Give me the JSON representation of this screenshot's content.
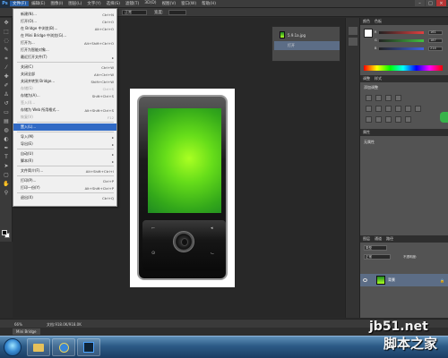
{
  "menubar": {
    "logo": "Ps",
    "items": [
      "文件(F)",
      "编辑(E)",
      "图像(I)",
      "图层(L)",
      "文字(Y)",
      "选择(S)",
      "滤镜(T)",
      "3D(D)",
      "视图(V)",
      "窗口(W)",
      "帮助(H)"
    ],
    "active_index": 0
  },
  "window_controls": {
    "minimize": "–",
    "maximize": "□",
    "close": "×"
  },
  "optbar": {
    "style_label": "样式:",
    "style_value": "正常",
    "width_label": "宽度:"
  },
  "file_menu": [
    {
      "label": "新建(N)...",
      "shortcut": "Ctrl+N",
      "sep_before": false,
      "disabled": false
    },
    {
      "label": "打开(O)...",
      "shortcut": "Ctrl+O",
      "sep_before": false,
      "disabled": false
    },
    {
      "label": "在 Bridge 中浏览(B)...",
      "shortcut": "Alt+Ctrl+O",
      "sep_before": false,
      "disabled": false
    },
    {
      "label": "在 Mini Bridge 中浏览(G)...",
      "shortcut": "",
      "sep_before": false,
      "disabled": false
    },
    {
      "label": "打开为...",
      "shortcut": "Alt+Shift+Ctrl+O",
      "sep_before": false,
      "disabled": false
    },
    {
      "label": "打开为智能对象...",
      "shortcut": "",
      "sep_before": false,
      "disabled": false
    },
    {
      "label": "最近打开文件(T)",
      "shortcut": "▸",
      "sep_before": false,
      "disabled": false
    },
    {
      "label": "关闭(C)",
      "shortcut": "Ctrl+W",
      "sep_before": true,
      "disabled": false
    },
    {
      "label": "关闭全部",
      "shortcut": "Alt+Ctrl+W",
      "sep_before": false,
      "disabled": false
    },
    {
      "label": "关闭并转到 Bridge...",
      "shortcut": "Shift+Ctrl+W",
      "sep_before": false,
      "disabled": false
    },
    {
      "label": "存储(S)",
      "shortcut": "Ctrl+S",
      "sep_before": false,
      "disabled": true
    },
    {
      "label": "存储为(A)...",
      "shortcut": "Shift+Ctrl+S",
      "sep_before": false,
      "disabled": false
    },
    {
      "label": "签入(I)...",
      "shortcut": "",
      "sep_before": false,
      "disabled": true
    },
    {
      "label": "存储为 Web 所用格式...",
      "shortcut": "Alt+Shift+Ctrl+S",
      "sep_before": false,
      "disabled": false
    },
    {
      "label": "恢复(V)",
      "shortcut": "F12",
      "sep_before": false,
      "disabled": true
    },
    {
      "label": "置入(L)...",
      "shortcut": "",
      "sep_before": true,
      "disabled": false,
      "highlight": true
    },
    {
      "label": "导入(M)",
      "shortcut": "▸",
      "sep_before": true,
      "disabled": false
    },
    {
      "label": "导出(E)",
      "shortcut": "▸",
      "sep_before": false,
      "disabled": false
    },
    {
      "label": "自动(U)",
      "shortcut": "▸",
      "sep_before": true,
      "disabled": false
    },
    {
      "label": "脚本(R)",
      "shortcut": "▸",
      "sep_before": false,
      "disabled": false
    },
    {
      "label": "文件简介(F)...",
      "shortcut": "Alt+Shift+Ctrl+I",
      "sep_before": true,
      "disabled": false
    },
    {
      "label": "打印(P)...",
      "shortcut": "Ctrl+P",
      "sep_before": true,
      "disabled": false
    },
    {
      "label": "打印一份(Y)",
      "shortcut": "Alt+Shift+Ctrl+P",
      "sep_before": false,
      "disabled": false
    },
    {
      "label": "退出(X)",
      "shortcut": "Ctrl+Q",
      "sep_before": true,
      "disabled": false
    }
  ],
  "layer_comps": {
    "items": [
      {
        "label": "5.9.1a.jpg",
        "selected": false
      },
      {
        "label": "打开",
        "selected": true
      }
    ]
  },
  "color_panel": {
    "tabs": [
      "颜色",
      "色板"
    ],
    "sliders": [
      {
        "label": "R",
        "value": "161",
        "color": "#e04040"
      },
      {
        "label": "G",
        "value": "187",
        "color": "#40c040"
      },
      {
        "label": "B",
        "value": "214",
        "color": "#4060e0"
      }
    ]
  },
  "adjustments_panel": {
    "tabs": [
      "调整",
      "样式"
    ],
    "subtitle": "添加调整"
  },
  "properties_panel": {
    "tab": "属性",
    "text": "无属性"
  },
  "layers_panel": {
    "tabs": [
      "图层",
      "通道",
      "路径"
    ],
    "kind": "类型",
    "blend_mode": "正常",
    "opacity_label": "不透明度:",
    "layer_name": "背景"
  },
  "statusbar": {
    "zoom": "66%",
    "doc_info": "文档:918.0K/918.0K"
  },
  "minibridge_tab": "Mini Bridge",
  "watermark": {
    "site": "jb51.net",
    "name": "脚本之家"
  }
}
